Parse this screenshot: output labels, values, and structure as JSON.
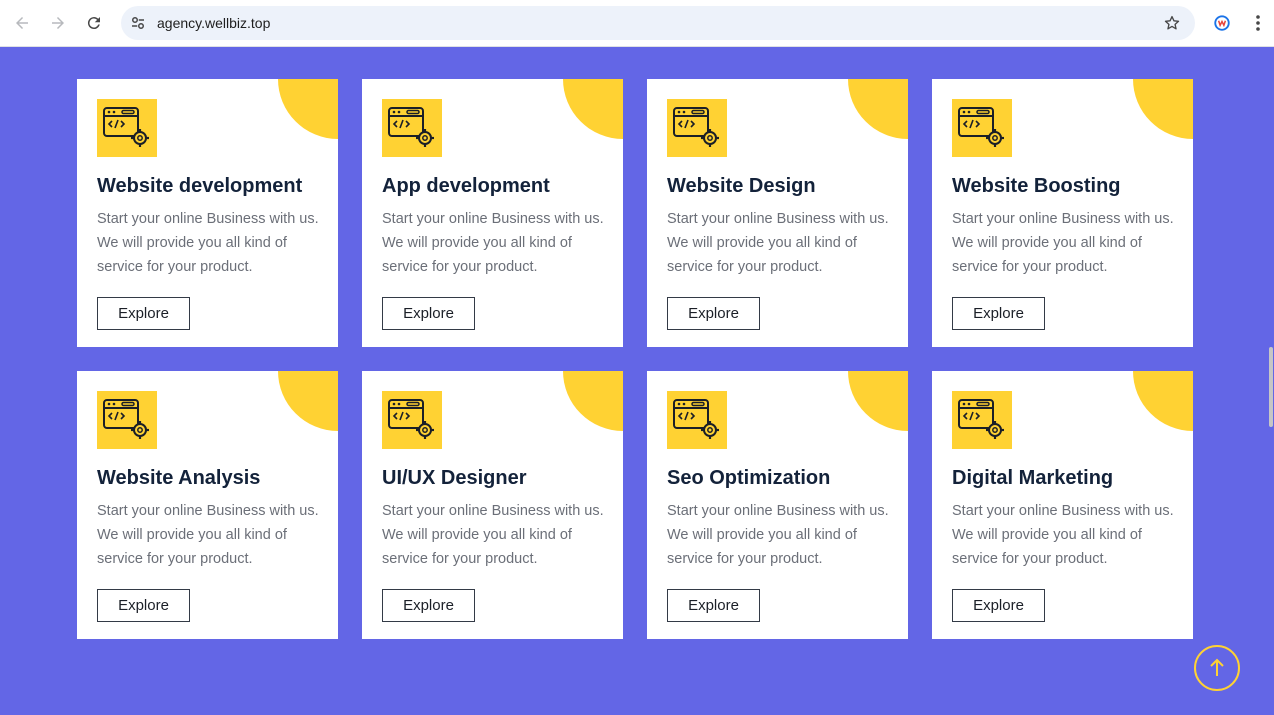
{
  "browser": {
    "url": "agency.wellbiz.top",
    "icons": {
      "back": "arrow-left-icon",
      "forward": "arrow-right-icon",
      "reload": "reload-icon",
      "site_settings": "tune-icon",
      "bookmark": "star-icon",
      "extension": "extension-icon",
      "menu": "more-vert-icon"
    }
  },
  "colors": {
    "page_bg": "#6366e6",
    "accent": "#ffd233",
    "card_bg": "#ffffff",
    "title": "#13223a",
    "body_text": "#6b6f78"
  },
  "services": [
    {
      "title": "Website development",
      "desc": "Start your online Business with us. We will provide you all kind of service for your product.",
      "button": "Explore",
      "icon": "code-settings-icon"
    },
    {
      "title": "App development",
      "desc": "Start your online Business with us. We will provide you all kind of service for your product.",
      "button": "Explore",
      "icon": "code-settings-icon"
    },
    {
      "title": "Website Design",
      "desc": "Start your online Business with us. We will provide you all kind of service for your product.",
      "button": "Explore",
      "icon": "code-settings-icon"
    },
    {
      "title": "Website Boosting",
      "desc": "Start your online Business with us. We will provide you all kind of service for your product.",
      "button": "Explore",
      "icon": "code-settings-icon"
    },
    {
      "title": "Website Analysis",
      "desc": "Start your online Business with us. We will provide you all kind of service for your product.",
      "button": "Explore",
      "icon": "code-settings-icon"
    },
    {
      "title": "UI/UX Designer",
      "desc": "Start your online Business with us. We will provide you all kind of service for your product.",
      "button": "Explore",
      "icon": "code-settings-icon"
    },
    {
      "title": "Seo Optimization",
      "desc": "Start your online Business with us. We will provide you all kind of service for your product.",
      "button": "Explore",
      "icon": "code-settings-icon"
    },
    {
      "title": "Digital Marketing",
      "desc": "Start your online Business with us. We will provide you all kind of service for your product.",
      "button": "Explore",
      "icon": "code-settings-icon"
    }
  ],
  "scroll_to_top": {
    "icon": "arrow-up-icon"
  }
}
